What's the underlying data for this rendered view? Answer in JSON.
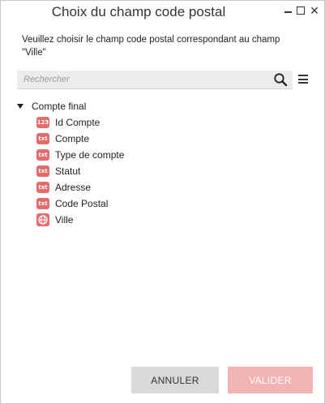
{
  "dialog": {
    "title": "Choix du champ code postal",
    "message_line1": "Veuillez choisir le champ code postal correspondant au champ",
    "message_line2": "\"Ville\""
  },
  "search": {
    "placeholder": "Rechercher",
    "value": ""
  },
  "tree": {
    "root_label": "Compte final",
    "items": [
      {
        "label": "Id Compte",
        "type": "123"
      },
      {
        "label": "Compte",
        "type": "txt"
      },
      {
        "label": "Type de compte",
        "type": "txt"
      },
      {
        "label": "Statut",
        "type": "txt"
      },
      {
        "label": "Adresse",
        "type": "txt"
      },
      {
        "label": "Code Postal",
        "type": "txt"
      },
      {
        "label": "Ville",
        "type": "geo"
      }
    ]
  },
  "buttons": {
    "cancel_label": "ANNULER",
    "ok_label": "VALIDER"
  },
  "colors": {
    "field_icon": "#e36c6c",
    "ok_button_disabled": "#f2b3b3",
    "cancel_button": "#d9d9d9"
  }
}
